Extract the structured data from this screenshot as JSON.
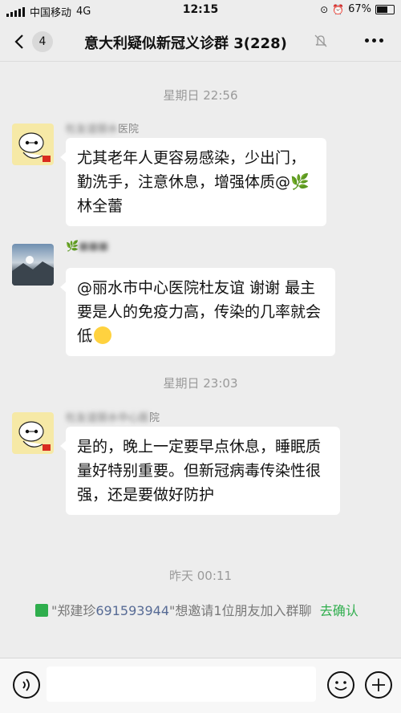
{
  "status": {
    "carrier": "中国移动",
    "network": "4G",
    "time": "12:15",
    "battery": "67%",
    "battery_level": 0.67
  },
  "header": {
    "unread": "4",
    "title": "意大利疑似新冠义诊群 3(228)"
  },
  "messages": [
    {
      "timestamp": "星期日 22:56",
      "sender_tail": "医院",
      "text": "尤其老年人更容易感染，少出门，勤洗手，注意休息，增强体质@",
      "mention_name": "林全蕾"
    },
    {
      "text": "@丽水市中心医院杜友谊 谢谢 最主要是人的免疫力高，传染的几率就会低"
    },
    {
      "timestamp": "星期日 23:03",
      "sender_tail": "院",
      "text": "是的，晚上一定要早点休息，睡眠质量好特别重要。但新冠病毒传染性很强，还是要做好防护"
    }
  ],
  "system": {
    "timestamp": "昨天 00:11",
    "prefix": "\"郑建珍",
    "id_link": "691593944",
    "middle": "\"想邀请1位朋友加入群聊",
    "action": "去确认"
  }
}
